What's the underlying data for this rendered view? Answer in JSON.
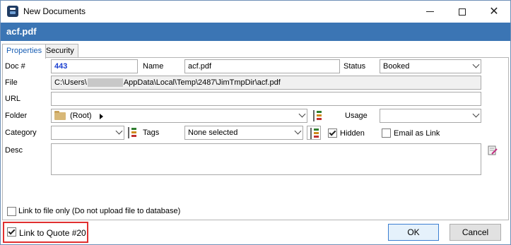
{
  "window": {
    "title": "New Documents",
    "header_title": "acf.pdf"
  },
  "tabs": [
    {
      "label": "Properties",
      "active": true
    },
    {
      "label": "Security",
      "active": false
    }
  ],
  "form": {
    "doc_label": "Doc #",
    "doc_value": "443",
    "name_label": "Name",
    "name_value": "acf.pdf",
    "status_label": "Status",
    "status_value": "Booked",
    "file_label": "File",
    "file_value_prefix": "C:\\Users\\",
    "file_value_suffix": "AppData\\Local\\Temp\\2487\\JimTmpDir\\acf.pdf",
    "url_label": "URL",
    "url_value": "",
    "folder_label": "Folder",
    "folder_value": "(Root)",
    "usage_label": "Usage",
    "usage_value": "",
    "category_label": "Category",
    "category_value": "",
    "tags_label": "Tags",
    "tags_value": "None selected",
    "hidden_label": "Hidden",
    "hidden_checked": true,
    "email_link_label": "Email as Link",
    "email_link_checked": false,
    "desc_label": "Desc",
    "desc_value": ""
  },
  "footer": {
    "link_file_only_label": "Link to file only (Do not upload file to database)",
    "link_file_only_checked": false,
    "link_quote_label": "Link to Quote #20",
    "link_quote_checked": true,
    "ok_label": "OK",
    "cancel_label": "Cancel"
  },
  "colors": {
    "header_band": "#3b75b4",
    "doc_number": "#1a3fd0",
    "highlight": "#e03030",
    "active_tab_text": "#1a5fb4"
  }
}
